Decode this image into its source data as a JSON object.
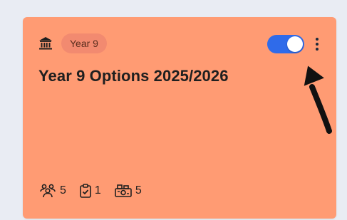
{
  "card": {
    "badge": "Year 9",
    "title": "Year 9 Options 2025/2026",
    "toggle_on": true,
    "stats": [
      {
        "icon": "students-icon",
        "value": "5"
      },
      {
        "icon": "clipboard-check-icon",
        "value": "1"
      },
      {
        "icon": "subjects-icon",
        "value": "5"
      }
    ]
  },
  "colors": {
    "page_bg": "#e9ecf3",
    "card_bg": "#ff9b73",
    "badge_bg": "#f28a70",
    "toggle_on": "#2f6bea",
    "text": "#1f1f1f"
  }
}
